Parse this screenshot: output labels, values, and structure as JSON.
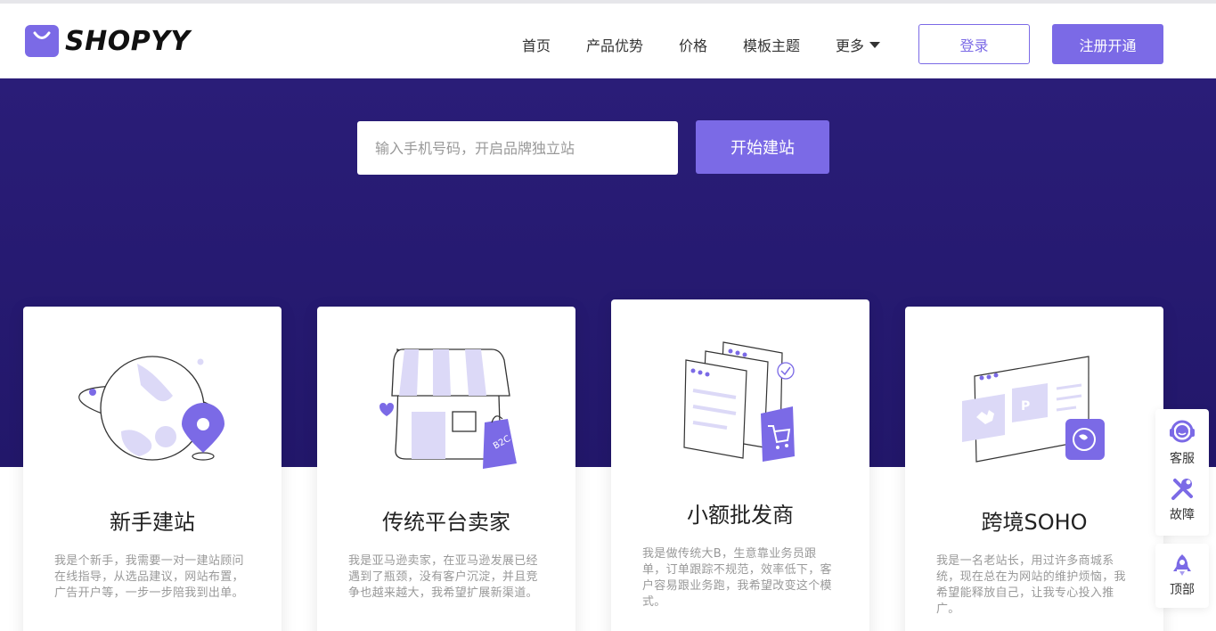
{
  "brand": {
    "name": "SHOPYY",
    "accent": "#7b6ae6",
    "hero_bg": "#2a1d78"
  },
  "nav": {
    "items": [
      {
        "label": "首页"
      },
      {
        "label": "产品优势"
      },
      {
        "label": "价格"
      },
      {
        "label": "模板主题"
      },
      {
        "label": "更多"
      }
    ],
    "login_label": "登录",
    "register_label": "注册开通"
  },
  "hero": {
    "search": {
      "placeholder": "输入手机号码，开启品牌独立站",
      "value": ""
    },
    "start_label": "开始建站"
  },
  "cards": [
    {
      "title": "新手建站",
      "desc": "我是个新手，我需要一对一建站顾问在线指导，从选品建议，网站布置，广告开户等，一步一步陪我到出单。",
      "icon": "globe-pin-icon"
    },
    {
      "title": "传统平台卖家",
      "desc": "我是亚马逊卖家，在亚马逊发展已经遇到了瓶颈，没有客户沉淀，并且竞争也越来越大，我希望扩展新渠道。",
      "icon": "store-b2c-icon",
      "badge": "B2C"
    },
    {
      "title": "小额批发商",
      "desc": "我是做传统大B，生意靠业务员跟单，订单跟踪不规范，效率低下，客户容易跟业务跑，我希望改变这个模式。",
      "icon": "documents-cart-icon"
    },
    {
      "title": "跨境SOHO",
      "desc": "我是一名老站长，用过许多商城系统，现在总在为网站的维护烦恼，我希望能释放自己，让我专心投入推广。",
      "icon": "browser-payment-icon"
    }
  ],
  "side": {
    "service_label": "客服",
    "fault_label": "故障",
    "top_label": "顶部"
  }
}
